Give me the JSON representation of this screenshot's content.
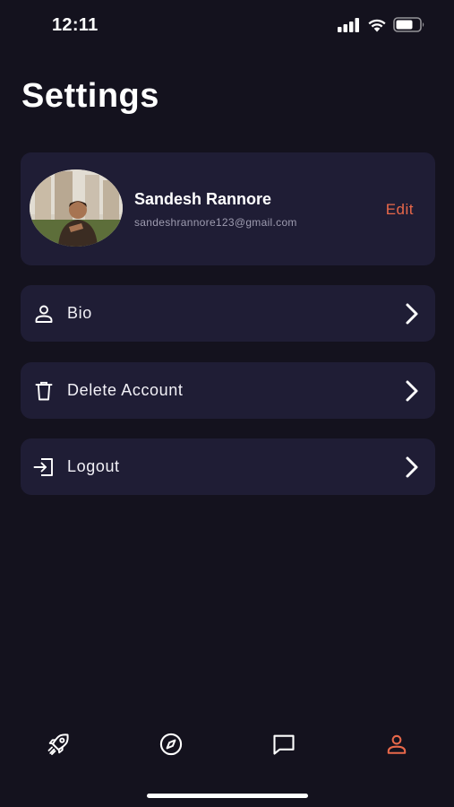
{
  "status_bar": {
    "time": "12:11"
  },
  "page": {
    "title": "Settings"
  },
  "profile": {
    "name": "Sandesh Rannore",
    "email": "sandeshrannore123@gmail.com",
    "edit_label": "Edit"
  },
  "menu": [
    {
      "label": "Bio",
      "icon": "person-icon"
    },
    {
      "label": "Delete Account",
      "icon": "trash-icon"
    },
    {
      "label": "Logout",
      "icon": "logout-icon"
    }
  ],
  "tabs": [
    {
      "icon": "rocket-icon"
    },
    {
      "icon": "compass-icon"
    },
    {
      "icon": "chat-icon"
    },
    {
      "icon": "person-icon",
      "active": true
    }
  ],
  "colors": {
    "background": "#14121e",
    "card": "#1f1d35",
    "accent": "#e8684a",
    "text": "#ffffff",
    "muted": "#9e9cb0"
  }
}
